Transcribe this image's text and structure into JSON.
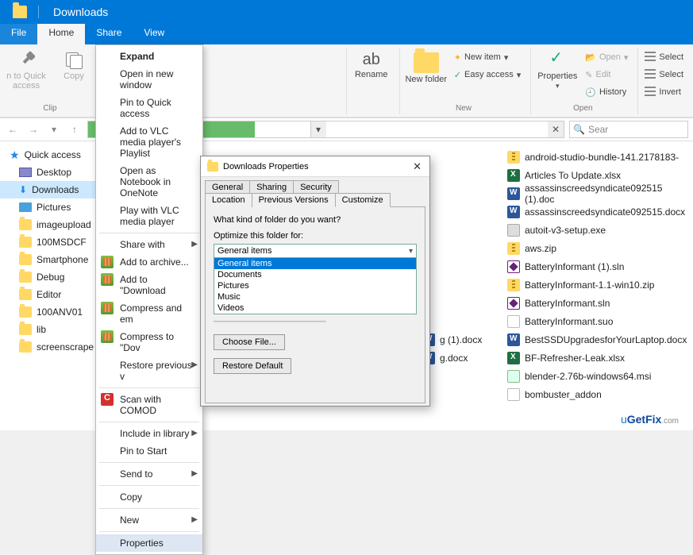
{
  "titlebar": {
    "title": "Downloads"
  },
  "tabs": {
    "file": "File",
    "home": "Home",
    "share": "Share",
    "view": "View"
  },
  "ribbon": {
    "pin": "n to Quick access",
    "copy": "Copy",
    "group1": "Clip",
    "rename": "Rename",
    "newfolder": "New folder",
    "newitem": "New item",
    "easyaccess": "Easy access",
    "groupNew": "New",
    "properties": "Properties",
    "open": "Open",
    "edit": "Edit",
    "history": "History",
    "groupOpen": "Open",
    "selectall": "Select",
    "selectnone": "Select",
    "invert": "Invert"
  },
  "addr": {
    "search_ph": "Sear"
  },
  "nav": {
    "quick": "Quick access",
    "desktop": "Desktop",
    "downloads": "Downloads",
    "pictures": "Pictures",
    "items": [
      "imageupload",
      "100MSDCF",
      "Smartphone",
      "Debug",
      "Editor",
      "100ANV01",
      "lib",
      "screenscrape"
    ]
  },
  "ctx": {
    "expand": "Expand",
    "openwin": "Open in new window",
    "pinquick": "Pin to Quick access",
    "vlcplaylist": "Add to VLC media player's Playlist",
    "onenote": "Open as Notebook in OneNote",
    "vlcplay": "Play with VLC media player",
    "sharewith": "Share with",
    "addarchive": "Add to archive...",
    "adddown": "Add to \"Download",
    "compem": "Compress and em",
    "compdov": "Compress to \"Dov",
    "restore": "Restore previous v",
    "comodo": "Scan with COMOD",
    "include": "Include in library",
    "pinstart": "Pin to Start",
    "sendto": "Send to",
    "copy": "Copy",
    "new": "New",
    "properties": "Properties"
  },
  "dialog": {
    "title": "Downloads Properties",
    "tabs": {
      "general": "General",
      "sharing": "Sharing",
      "security": "Security",
      "location": "Location",
      "prev": "Previous Versions",
      "customize": "Customize"
    },
    "q": "What kind of folder do you want?",
    "optlbl": "Optimize this folder for:",
    "sel": "General items",
    "opts": [
      "General items",
      "Documents",
      "Pictures",
      "Music",
      "Videos"
    ],
    "choose": "Choose File...",
    "restore": "Restore Default"
  },
  "files": {
    "mid": [
      "g (1).docx",
      "g.docx"
    ],
    "right": [
      {
        "t": "zip",
        "n": "android-studio-bundle-141.2178183-"
      },
      {
        "t": "xls",
        "n": "Articles To Update.xlsx"
      },
      {
        "t": "doc",
        "n": "assassinscreedsyndicate092515 (1).doc"
      },
      {
        "t": "doc",
        "n": "assassinscreedsyndicate092515.docx"
      },
      {
        "t": "exe",
        "n": "autoit-v3-setup.exe"
      },
      {
        "t": "zip",
        "n": "aws.zip"
      },
      {
        "t": "sln",
        "n": "BatteryInformant (1).sln"
      },
      {
        "t": "zip",
        "n": "BatteryInformant-1.1-win10.zip"
      },
      {
        "t": "sln",
        "n": "BatteryInformant.sln"
      },
      {
        "t": "suo",
        "n": "BatteryInformant.suo"
      },
      {
        "t": "doc",
        "n": "BestSSDUpgradesforYourLaptop.docx"
      },
      {
        "t": "xls",
        "n": "BF-Refresher-Leak.xlsx"
      },
      {
        "t": "msi",
        "n": "blender-2.76b-windows64.msi"
      },
      {
        "t": "gen",
        "n": "bombuster_addon"
      }
    ]
  },
  "watermark": {
    "a": "u",
    "b": "GetFix",
    "c": ".com"
  }
}
